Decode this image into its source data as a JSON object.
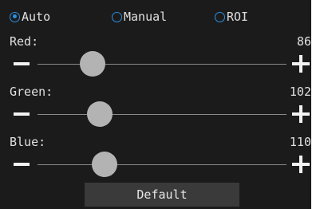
{
  "mode_radios": [
    {
      "label": "Auto",
      "selected": true
    },
    {
      "label": "Manual",
      "selected": false
    },
    {
      "label": "ROI",
      "selected": false
    }
  ],
  "sliders": [
    {
      "label": "Red:",
      "value": "86",
      "fraction": 0.22
    },
    {
      "label": "Green:",
      "value": "102",
      "fraction": 0.25
    },
    {
      "label": "Blue:",
      "value": "110",
      "fraction": 0.27
    }
  ],
  "default_button": {
    "label": "Default"
  },
  "colors": {
    "panel_bg": "#1b1b1b",
    "accent_radio": "#2d8fe0",
    "thumb": "#b3b3b3",
    "button_bg": "#3a3a3a"
  },
  "icons": {
    "decrease": "minus-icon",
    "increase": "plus-icon",
    "radio": "radio-icon"
  }
}
